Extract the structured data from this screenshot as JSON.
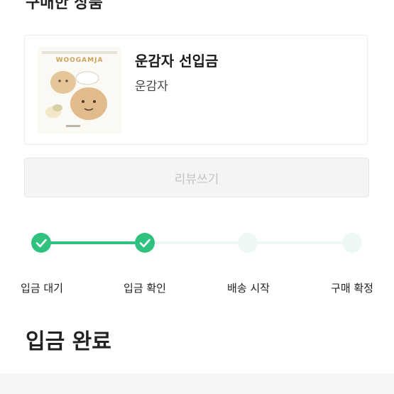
{
  "section": {
    "title": "구매한 상품"
  },
  "product": {
    "name": "운감자 선입금",
    "seller": "운감자",
    "thumbnail_heading": "WOOGAMJA",
    "thumbnail_icon": "potato-character-illustration"
  },
  "review_button": {
    "label": "리뷰쓰기"
  },
  "progress": {
    "steps": [
      {
        "label": "입금 대기",
        "state": "done"
      },
      {
        "label": "입금 확인",
        "state": "done"
      },
      {
        "label": "배송 시작",
        "state": "pending"
      },
      {
        "label": "구매 확정",
        "state": "pending"
      }
    ],
    "completed_steps": 2,
    "total_steps": 4
  },
  "status": {
    "title": "입금 완료"
  },
  "colors": {
    "accent": "#2ec27e",
    "pending": "#eef8f2",
    "disabled_text": "#c4c4c4"
  }
}
